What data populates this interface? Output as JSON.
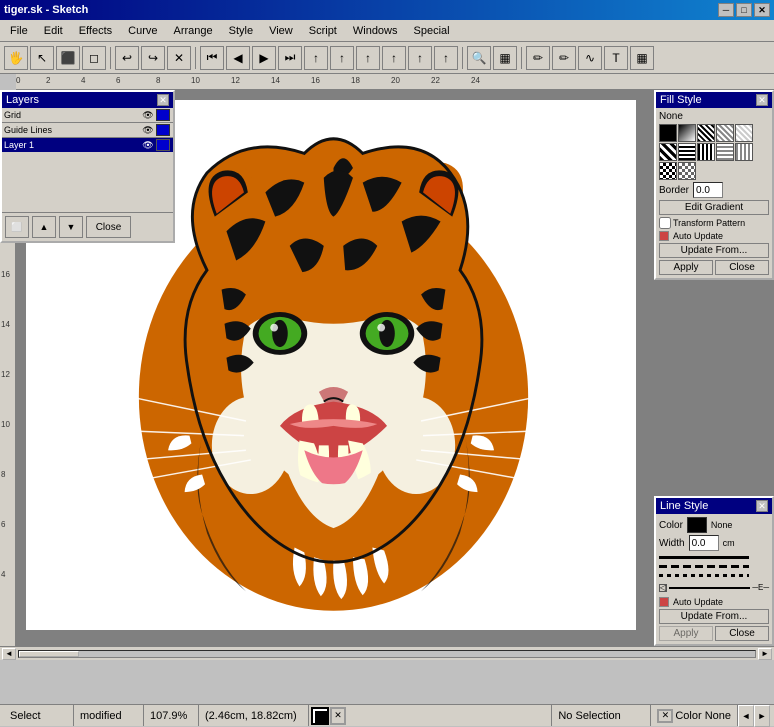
{
  "titlebar": {
    "title": "tiger.sk - Sketch",
    "close_btn": "✕",
    "min_btn": "─",
    "max_btn": "□"
  },
  "menu": {
    "items": [
      "File",
      "Edit",
      "Effects",
      "Curve",
      "Arrange",
      "Style",
      "View",
      "Script",
      "Windows",
      "Special"
    ]
  },
  "toolbar": {
    "tools": [
      "⬜",
      "🖐",
      "⬛",
      "◻",
      "↩",
      "↪",
      "✕",
      "⏮",
      "◀",
      "▶",
      "⏭",
      "⬆",
      "⬆",
      "⬆",
      "⬆",
      "⬆",
      "⬆",
      "🔍",
      "▦",
      "▦",
      "▦",
      "✏",
      "✏",
      "✏",
      "T",
      "▦"
    ]
  },
  "layers": {
    "title": "Layers",
    "close_btn": "✕",
    "items": [
      {
        "name": "Grid",
        "visible": true,
        "locked": false,
        "color": "#0000ff"
      },
      {
        "name": "Guide Lines",
        "visible": true,
        "locked": false,
        "color": "#0000ff"
      },
      {
        "name": "Layer 1",
        "visible": true,
        "locked": false,
        "color": "#0000ff",
        "selected": true
      }
    ],
    "footer_btns": [
      "⬜",
      "▲",
      "▼",
      "Close"
    ]
  },
  "fill_style": {
    "title": "Fill Style",
    "close_btn": "✕",
    "none_label": "None",
    "swatches": [
      "#000000",
      "#333333",
      "#555555",
      "#888888",
      "#aaaaaa",
      "#cccccc",
      "#000088",
      "#0000cc",
      "#8888cc",
      "#aaaadd",
      "#880000",
      "#cc0000",
      "#cc8800",
      "#cccc00",
      "#008800",
      "#00cc00",
      "#00cccc",
      "#0088cc",
      "#ffffff",
      "#ffcccc",
      "#ccffcc",
      "#ccccff"
    ],
    "border_label": "Border",
    "border_value": "0.0",
    "edit_gradient_btn": "Edit Gradient",
    "transform_pattern_btn": "Transform Pattern",
    "auto_update_label": "Auto Update",
    "update_from_btn": "Update From...",
    "apply_btn": "Apply",
    "close_btn2": "Close"
  },
  "line_style": {
    "title": "Line Style",
    "close_btn": "✕",
    "color_label": "Color",
    "color_value": "#000000",
    "none_label": "None",
    "width_label": "Width",
    "width_value": "0.0",
    "unit_label": "cm",
    "auto_update_label": "Auto Update",
    "update_from_btn": "Update From...",
    "apply_btn": "Apply",
    "close_btn2": "Close"
  },
  "statusbar": {
    "tool": "Select",
    "state": "modified",
    "zoom": "107.9%",
    "coords": "(2.46cm, 18.82cm)",
    "selection": "No Selection",
    "color_none": "Color None"
  },
  "palette_colors": [
    "#ff0000",
    "#ff4400",
    "#ff8800",
    "#ffcc00",
    "#ffff00",
    "#ccff00",
    "#88ff00",
    "#44ff00",
    "#00ff00",
    "#00ff44",
    "#00ff88",
    "#00ffcc",
    "#00ffff",
    "#00ccff",
    "#0088ff",
    "#0044ff",
    "#0000ff",
    "#4400ff",
    "#8800ff",
    "#cc00ff",
    "#ff00ff",
    "#ff00cc",
    "#ff0088",
    "#ff0044",
    "#ffffff",
    "#cccccc",
    "#888888",
    "#444444",
    "#000000"
  ]
}
